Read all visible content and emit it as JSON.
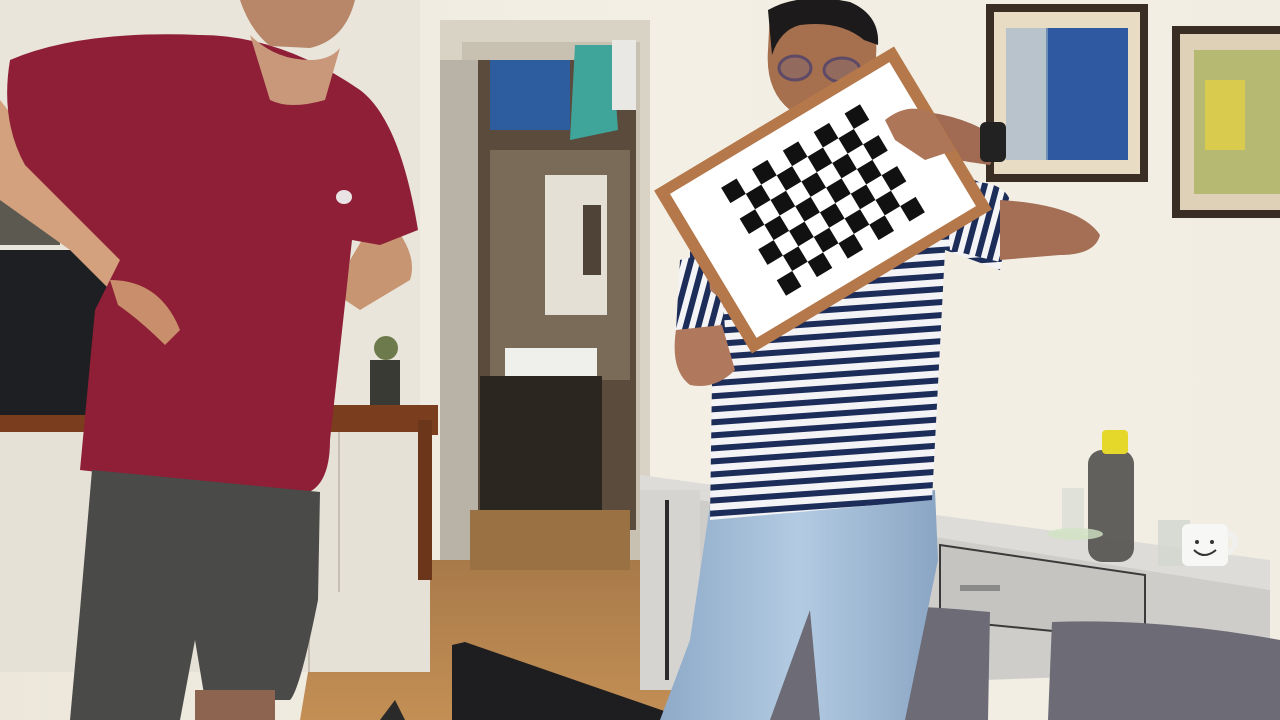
{
  "scene": {
    "description_free": true,
    "elements": [
      "wall",
      "doorway",
      "bathroom",
      "floor",
      "cabinet-left",
      "tv",
      "person-left",
      "person-right",
      "calibration-board",
      "sideboard",
      "water-bottle",
      "mug",
      "glasses",
      "painting-1",
      "painting-2",
      "pillows",
      "laptop"
    ]
  },
  "calibration_board": {
    "rows": 7,
    "cols": 9
  },
  "colors": {
    "wall": "#f1ede2",
    "maroon_shirt": "#8e1f36",
    "shorts": "#4a4a48",
    "floor": "#b27f48",
    "jeans": "#9db8d6",
    "stripe_navy": "#1c2d5a",
    "board_frame": "#b5784a",
    "bottle_cap": "#e6d82a",
    "pillow": "#6c6b76"
  }
}
